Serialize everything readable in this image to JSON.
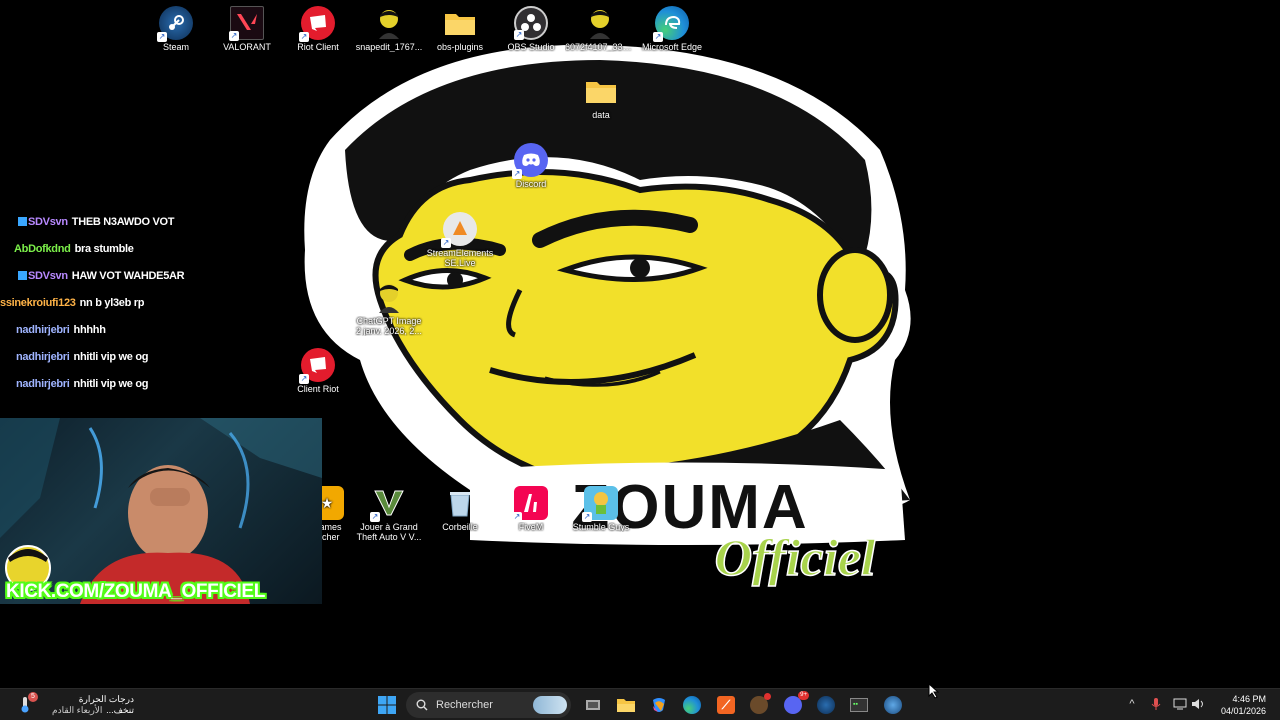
{
  "desktop_icons": [
    {
      "label": "Steam"
    },
    {
      "label": "VALORANT"
    },
    {
      "label": "Riot Client"
    },
    {
      "label": "snapedit_1767..."
    },
    {
      "label": "obs-plugins"
    },
    {
      "label": "OBS Studio"
    },
    {
      "label": "6072f4107_337..."
    },
    {
      "label": "Microsoft Edge"
    },
    {
      "label": "data"
    },
    {
      "label": "Discord"
    },
    {
      "label": "StreamElements SE.Live"
    },
    {
      "label": "ChatGPT Image 2 janv. 2026, 2..."
    },
    {
      "label": "Client Riot"
    },
    {
      "label": "Games ...cher"
    },
    {
      "label": "Jouer à Grand Theft Auto V V..."
    },
    {
      "label": "Corbeille"
    },
    {
      "label": "FiveM"
    },
    {
      "label": "Stumble Guys"
    }
  ],
  "wallpaper": {
    "brand_main": "ZOUMA",
    "brand_sub": "Officiel"
  },
  "chat": [
    {
      "user": "SDVsvn",
      "text": "THEB N3AWDO VOT",
      "color": "#b889ff",
      "badge": true
    },
    {
      "user": "AbDofkdnd",
      "text": "bra stumble",
      "color": "#7cf04a",
      "badge": false
    },
    {
      "user": "SDVsvn",
      "text": "HAW VOT WAHDE5AR",
      "color": "#b889ff",
      "badge": true
    },
    {
      "user": "ssinekroiufi123",
      "text": "nn b yl3eb rp",
      "color": "#ffb347",
      "badge": false
    },
    {
      "user": "nadhirjebri",
      "text": "hhhhh",
      "color": "#9fb4ff",
      "badge": false
    },
    {
      "user": "nadhirjebri",
      "text": "nhitli vip we og",
      "color": "#9fb4ff",
      "badge": false
    },
    {
      "user": "nadhirjebri",
      "text": "nhitli vip we og",
      "color": "#9fb4ff",
      "badge": false
    }
  ],
  "overlay": {
    "kick_url": "KICK.COM/ZOUMA_OFFICIEL"
  },
  "taskbar": {
    "weather_line1": "درجات الحرارة تنخف...",
    "weather_line2": "الأربعاء القادم",
    "weather_badge": "5",
    "search_placeholder": "Rechercher",
    "time": "4:46 PM",
    "date": "04/01/2026",
    "discord_badge": "9+"
  },
  "colors": {
    "taskbar_bg": "#1c1c1c",
    "kick_green": "#53fc18",
    "mascot_yellow": "#f2e02a"
  }
}
